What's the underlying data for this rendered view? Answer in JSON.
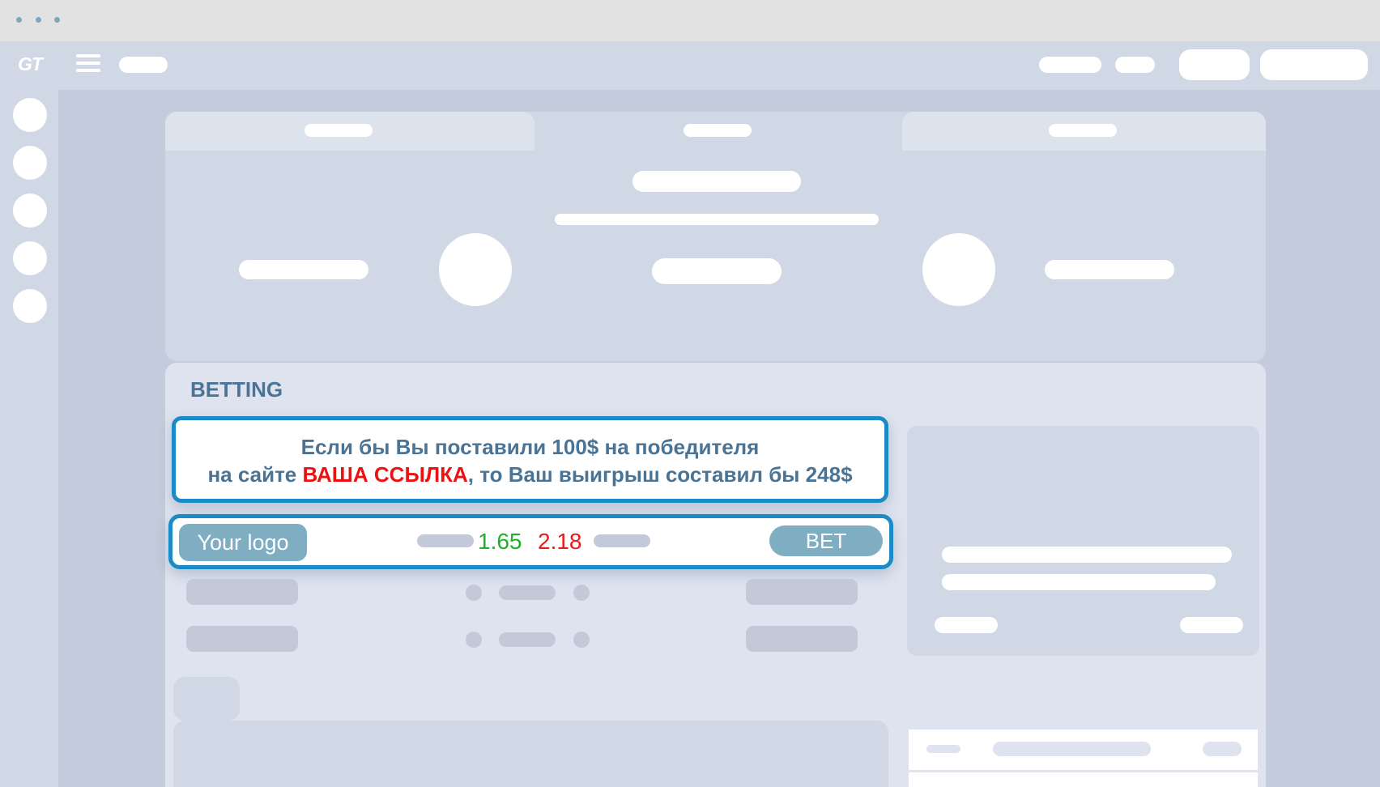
{
  "betting": {
    "title": "BETTING",
    "promo": {
      "line1": "Если бы Вы поставили 100$ на победителя",
      "line2_before": "на сайте ",
      "line2_link": "ВАША ССЫЛКА",
      "line2_after": ", то Ваш выигрыш составил бы 248$"
    },
    "bet_row": {
      "logo_label": "Your logo",
      "odd_home": "1.65",
      "odd_away": "2.18",
      "bet_label": "BET"
    }
  },
  "brand": {
    "logo_text": "GT"
  },
  "colors": {
    "accent_border": "#1a8bc7",
    "heading": "#4a7394",
    "link": "#ee1111",
    "odd_home": "#1fb027",
    "odd_away": "#e81a1a",
    "button": "#7faec3"
  }
}
